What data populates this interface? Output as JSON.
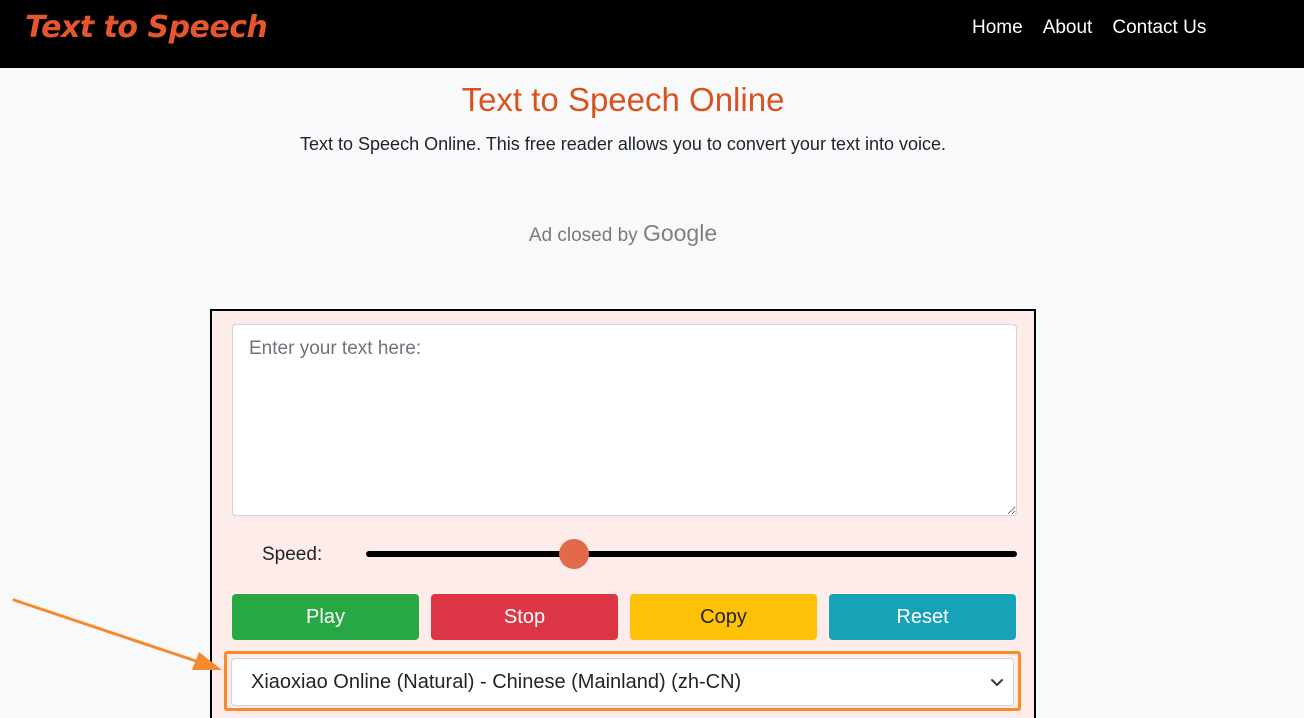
{
  "navbar": {
    "brand": "Text to Speech",
    "links": [
      "Home",
      "About",
      "Contact Us"
    ]
  },
  "header": {
    "title": "Text to Speech Online",
    "subtitle": "Text to Speech Online. This free reader allows you to convert your text into voice."
  },
  "ad": {
    "text": "Ad closed by",
    "brand": "Google"
  },
  "tool": {
    "textarea": {
      "placeholder": "Enter your text here:",
      "value": ""
    },
    "speed": {
      "label": "Speed:",
      "value_fraction": 0.32
    },
    "buttons": {
      "play": "Play",
      "stop": "Stop",
      "copy": "Copy",
      "reset": "Reset"
    },
    "voice_select": {
      "selected": "Xiaoxiao Online (Natural) - Chinese (Mainland) (zh-CN)"
    }
  },
  "annotation": {
    "color": "#f68a2c"
  },
  "colors": {
    "brand": "#e4572e",
    "title": "#d9531e",
    "play": "#28a745",
    "stop": "#dc3545",
    "copy": "#ffc107",
    "reset": "#17a2b8",
    "slider_thumb": "#e26a4b"
  }
}
